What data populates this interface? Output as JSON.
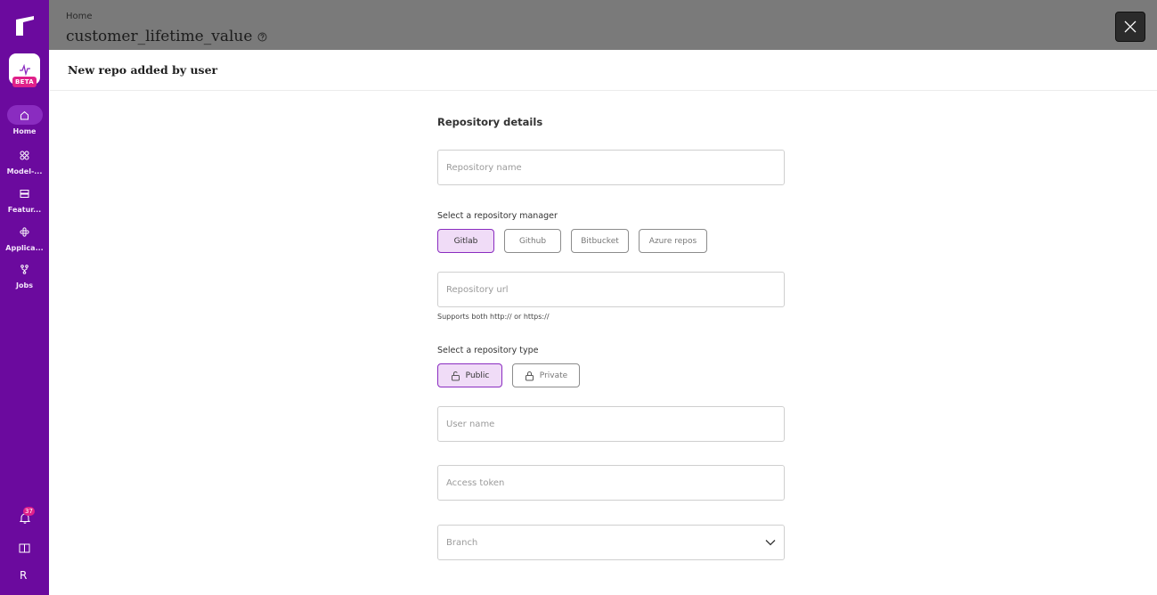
{
  "sidebar": {
    "beta_label": "BETA",
    "nav": [
      {
        "label": "Home",
        "icon": "home-icon"
      },
      {
        "label": "Model-...",
        "icon": "model-icon"
      },
      {
        "label": "Featur...",
        "icon": "feature-icon"
      },
      {
        "label": "Applica...",
        "icon": "application-icon"
      },
      {
        "label": "Jobs",
        "icon": "jobs-icon"
      }
    ],
    "notification_count": "37",
    "avatar_letter": "R",
    "colors": {
      "background": "#6b0a9e",
      "active": "#8a2cc0",
      "badge": "#e0218a"
    }
  },
  "page": {
    "breadcrumb": "Home",
    "title": "customer_lifetime_value"
  },
  "modal": {
    "title": "New repo added by user",
    "section_title": "Repository details",
    "repo_name_placeholder": "Repository name",
    "manager_label": "Select a repository manager",
    "managers": [
      "Gitlab",
      "Github",
      "Bitbucket",
      "Azure repos"
    ],
    "selected_manager": "Gitlab",
    "repo_url_placeholder": "Repository url",
    "repo_url_hint": "Supports both http:// or https://",
    "type_label": "Select a repository type",
    "types": [
      "Public",
      "Private"
    ],
    "selected_type": "Public",
    "username_placeholder": "User name",
    "token_placeholder": "Access token",
    "branch_placeholder": "Branch"
  }
}
